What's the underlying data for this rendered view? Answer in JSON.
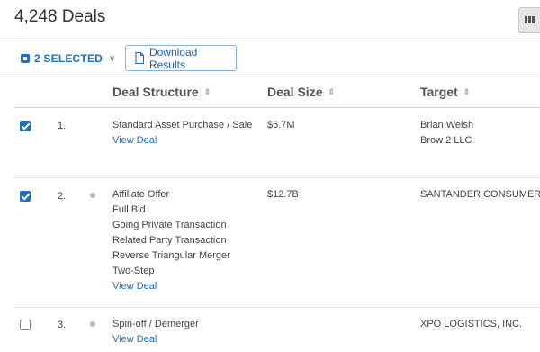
{
  "header": {
    "title": "4,248 Deals"
  },
  "toolbar": {
    "selected_label": "2 SELECTED",
    "download_label": "Download Results"
  },
  "columns": {
    "structure": "Deal Structure",
    "size": "Deal Size",
    "target": "Target"
  },
  "rows": [
    {
      "num": "1.",
      "checked": true,
      "structures": [
        "Standard Asset Purchase / Sale"
      ],
      "link": "View Deal",
      "size": "$6.7M",
      "target": [
        "Brian Welsh",
        "Brow 2 LLC"
      ]
    },
    {
      "num": "2.",
      "checked": true,
      "structures": [
        "Affiliate Offer",
        "Full Bid",
        "Going Private Transaction",
        "Related Party Transaction",
        "Reverse Triangular Merger",
        "Two-Step"
      ],
      "link": "View Deal",
      "size": "$12.7B",
      "target": [
        "SANTANDER CONSUMER U"
      ]
    },
    {
      "num": "3.",
      "checked": false,
      "structures": [
        "Spin-off / Demerger"
      ],
      "link": "View Deal",
      "size": "",
      "target": [
        "XPO LOGISTICS, INC."
      ]
    }
  ],
  "colors": {
    "accent": "#1f6fc2",
    "divider": "#e4e4e4"
  },
  "icons": {
    "selected": "checkbox-square-icon",
    "download": "document-icon",
    "sort": "sort-arrows-icon",
    "columns": "columns-icon"
  }
}
